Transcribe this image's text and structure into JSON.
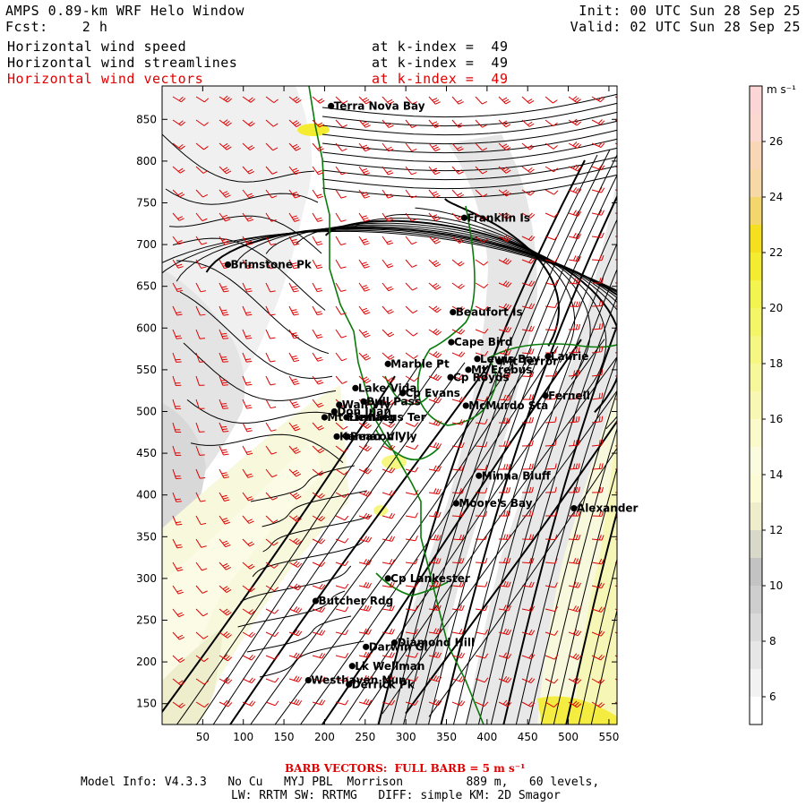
{
  "header": {
    "title": "AMPS 0.89-km WRF Helo Window",
    "fcst_label": "Fcst:",
    "fcst_value": "2 h",
    "init": "Init: 00 UTC Sun 28 Sep 25",
    "valid": "Valid: 02 UTC Sun 28 Sep 25",
    "fields": [
      {
        "name": "Horizontal wind speed",
        "level": "at k-index =  49",
        "color": "#000000"
      },
      {
        "name": "Horizontal wind streamlines",
        "level": "at k-index =  49",
        "color": "#000000"
      },
      {
        "name": "Horizontal wind vectors",
        "level": "at k-index =  49",
        "color": "#e00000"
      }
    ]
  },
  "axes": {
    "x_ticks": [
      50,
      100,
      150,
      200,
      250,
      300,
      350,
      400,
      450,
      500,
      550
    ],
    "y_ticks": [
      150,
      200,
      250,
      300,
      350,
      400,
      450,
      500,
      550,
      600,
      650,
      700,
      750,
      800,
      850
    ],
    "x_range": [
      0,
      560
    ],
    "y_range": [
      125,
      890
    ]
  },
  "colorbar": {
    "units": "m s⁻¹",
    "labels": [
      6,
      8,
      10,
      12,
      14,
      16,
      18,
      20,
      22,
      24,
      26
    ],
    "bands": [
      {
        "from": 5,
        "to": 6,
        "color": "#ffffff"
      },
      {
        "from": 6,
        "to": 7,
        "color": "#f2f2f2"
      },
      {
        "from": 7,
        "to": 8,
        "color": "#e6e6e6"
      },
      {
        "from": 8,
        "to": 9,
        "color": "#dadada"
      },
      {
        "from": 9,
        "to": 10,
        "color": "#cecece"
      },
      {
        "from": 10,
        "to": 11,
        "color": "#c3c3c3"
      },
      {
        "from": 11,
        "to": 12,
        "color": "#d9d9c9"
      },
      {
        "from": 12,
        "to": 13,
        "color": "#eeeecc"
      },
      {
        "from": 13,
        "to": 14,
        "color": "#fbfbd6"
      },
      {
        "from": 14,
        "to": 15,
        "color": "#fbfbe0"
      },
      {
        "from": 15,
        "to": 16,
        "color": "#fafaca"
      },
      {
        "from": 16,
        "to": 17,
        "color": "#f8f8b4"
      },
      {
        "from": 17,
        "to": 18,
        "color": "#f7f79c"
      },
      {
        "from": 18,
        "to": 19,
        "color": "#f6f682"
      },
      {
        "from": 19,
        "to": 20,
        "color": "#f5f568"
      },
      {
        "from": 20,
        "to": 21,
        "color": "#f4f450"
      },
      {
        "from": 21,
        "to": 22,
        "color": "#f4ec30"
      },
      {
        "from": 22,
        "to": 23,
        "color": "#f5e020"
      },
      {
        "from": 23,
        "to": 24,
        "color": "#f3d66c"
      },
      {
        "from": 24,
        "to": 25,
        "color": "#f6d9a6"
      },
      {
        "from": 25,
        "to": 26,
        "color": "#f8d6b6"
      },
      {
        "from": 26,
        "to": 27,
        "color": "#fbd8d0"
      },
      {
        "from": 27,
        "to": 28,
        "color": "#fcd6d6"
      }
    ],
    "range": [
      5,
      28
    ]
  },
  "places": [
    {
      "name": "Terra Nova Bay",
      "x": 208,
      "y": 866
    },
    {
      "name": "Franklin Is",
      "x": 372,
      "y": 732
    },
    {
      "name": "Brimstone Pk",
      "x": 81,
      "y": 676
    },
    {
      "name": "Beaufort Is",
      "x": 358,
      "y": 619
    },
    {
      "name": "Cape Bird",
      "x": 356,
      "y": 583
    },
    {
      "name": "Lewis Bay",
      "x": 388,
      "y": 563
    },
    {
      "name": "Mt Terror",
      "x": 415,
      "y": 560
    },
    {
      "name": "Laurie",
      "x": 475,
      "y": 566
    },
    {
      "name": "Marble Pt",
      "x": 278,
      "y": 557
    },
    {
      "name": "Mt Erebus",
      "x": 377,
      "y": 550
    },
    {
      "name": "Cp Royds",
      "x": 355,
      "y": 541
    },
    {
      "name": "Lake Vida",
      "x": 238,
      "y": 528
    },
    {
      "name": "Cp Evans",
      "x": 296,
      "y": 522
    },
    {
      "name": "Fernell",
      "x": 472,
      "y": 519
    },
    {
      "name": "Wall Vly",
      "x": 218,
      "y": 508
    },
    {
      "name": "Bull Pass",
      "x": 248,
      "y": 512
    },
    {
      "name": "McMurdo Sta",
      "x": 374,
      "y": 507
    },
    {
      "name": "Don Juan",
      "x": 212,
      "y": 500
    },
    {
      "name": "Mt Fleming",
      "x": 200,
      "y": 493
    },
    {
      "name": "Linnaeus Ter",
      "x": 227,
      "y": 493
    },
    {
      "name": "Kennar Vly",
      "x": 215,
      "y": 470
    },
    {
      "name": "Beacon Vly",
      "x": 228,
      "y": 470
    },
    {
      "name": "Minna Bluff",
      "x": 390,
      "y": 423
    },
    {
      "name": "Moore's Bay",
      "x": 362,
      "y": 390
    },
    {
      "name": "Alexander",
      "x": 507,
      "y": 384
    },
    {
      "name": "Cp Lankester",
      "x": 278,
      "y": 300
    },
    {
      "name": "Butcher Rdg",
      "x": 189,
      "y": 273
    },
    {
      "name": "Darwin Gl",
      "x": 251,
      "y": 218
    },
    {
      "name": "Diamond Hill",
      "x": 286,
      "y": 223
    },
    {
      "name": "Lk Wellman",
      "x": 234,
      "y": 195
    },
    {
      "name": "Westhaven Nun",
      "x": 180,
      "y": 178
    },
    {
      "name": "Derrick Pk",
      "x": 230,
      "y": 173
    }
  ],
  "footer": {
    "barb_text": "BARB VECTORS:  FULL BARB = 5 m s⁻¹",
    "model_info_1": "Model Info: V4.3.3   No Cu   MYJ PBL  Morrison         889 m,   60 levels,",
    "model_info_2": "LW: RRTM SW: RRTMG   DIFF: simple KM: 2D Smagor"
  },
  "colors": {
    "coast": "#0a7a0a",
    "barb": "#e00000",
    "streamline": "#000000"
  }
}
